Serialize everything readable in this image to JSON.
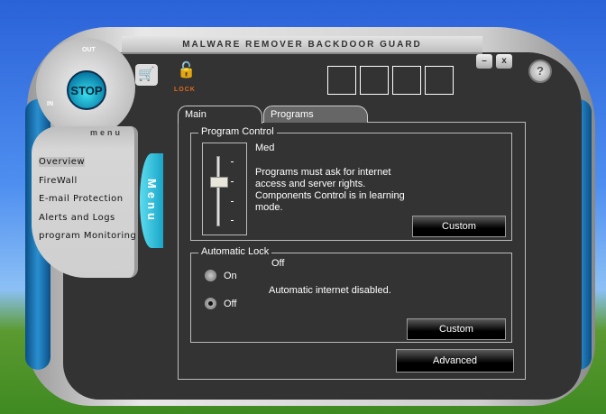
{
  "app": {
    "title": "MALWARE REMOVER BACKDOOR GUARD",
    "stop_label": "STOP",
    "out_label": "OUT",
    "in_label": "IN",
    "lock_label": "LOCK",
    "minimize": "–",
    "close": "x",
    "help": "?"
  },
  "menu": {
    "header": "menu",
    "tab_label": "Menu",
    "items": [
      {
        "label": "Overview"
      },
      {
        "label": "FireWall"
      },
      {
        "label": "E-mail Protection"
      },
      {
        "label": "Alerts and Logs"
      },
      {
        "label": "program Monitoring"
      }
    ]
  },
  "tabs": [
    {
      "label": "Main"
    },
    {
      "label": "Programs"
    }
  ],
  "program_control": {
    "title": "Program Control",
    "level": "Med",
    "slider_level_index": 1,
    "slider_levels": 4,
    "description": "Programs must ask for internet access and server rights. Components Control is in learning mode.",
    "custom_label": "Custom"
  },
  "automatic_lock": {
    "title": "Automatic Lock",
    "status": "Off",
    "on_label": "On",
    "off_label": "Off",
    "selected": "Off",
    "description": "Automatic internet disabled.",
    "custom_label": "Custom"
  },
  "advanced_label": "Advanced"
}
